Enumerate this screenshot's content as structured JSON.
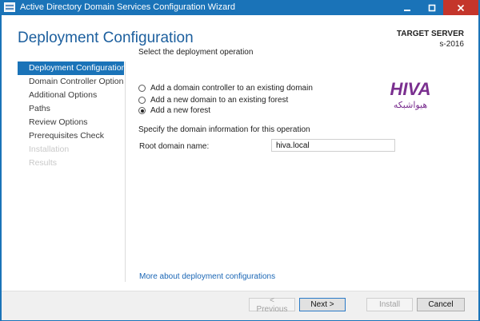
{
  "window": {
    "title": "Active Directory Domain Services Configuration Wizard"
  },
  "header": {
    "title": "Deployment Configuration",
    "target_label": "TARGET SERVER",
    "target_server": "s-2016"
  },
  "nav": {
    "items": [
      {
        "label": "Deployment Configuration",
        "state": "active"
      },
      {
        "label": "Domain Controller Options",
        "state": "enabled"
      },
      {
        "label": "Additional Options",
        "state": "enabled"
      },
      {
        "label": "Paths",
        "state": "enabled"
      },
      {
        "label": "Review Options",
        "state": "enabled"
      },
      {
        "label": "Prerequisites Check",
        "state": "enabled"
      },
      {
        "label": "Installation",
        "state": "disabled"
      },
      {
        "label": "Results",
        "state": "disabled"
      }
    ]
  },
  "main": {
    "operation_heading": "Select the deployment operation",
    "operations": [
      {
        "label": "Add a domain controller to an existing domain",
        "checked": false
      },
      {
        "label": "Add a new domain to an existing forest",
        "checked": false
      },
      {
        "label": "Add a new forest",
        "checked": true
      }
    ],
    "domain_heading": "Specify the domain information for this operation",
    "root_domain_label": "Root domain name:",
    "root_domain_value": "hiva.local",
    "help_link": "More about deployment configurations"
  },
  "watermark": {
    "brand": "HIVA",
    "brand_local": "هیواشبکه",
    "color": "#7a2f8f"
  },
  "footer": {
    "previous_label": "< Previous",
    "next_label": "Next >",
    "install_label": "Install",
    "cancel_label": "Cancel"
  },
  "colors": {
    "accent": "#1a73b8",
    "title_text": "#1c5f9e",
    "close_button": "#c4352b",
    "link": "#1a66b5"
  },
  "icons": {
    "app": "server-wizard-icon",
    "minimize": "minimize-icon",
    "maximize": "maximize-icon",
    "close": "close-icon"
  }
}
